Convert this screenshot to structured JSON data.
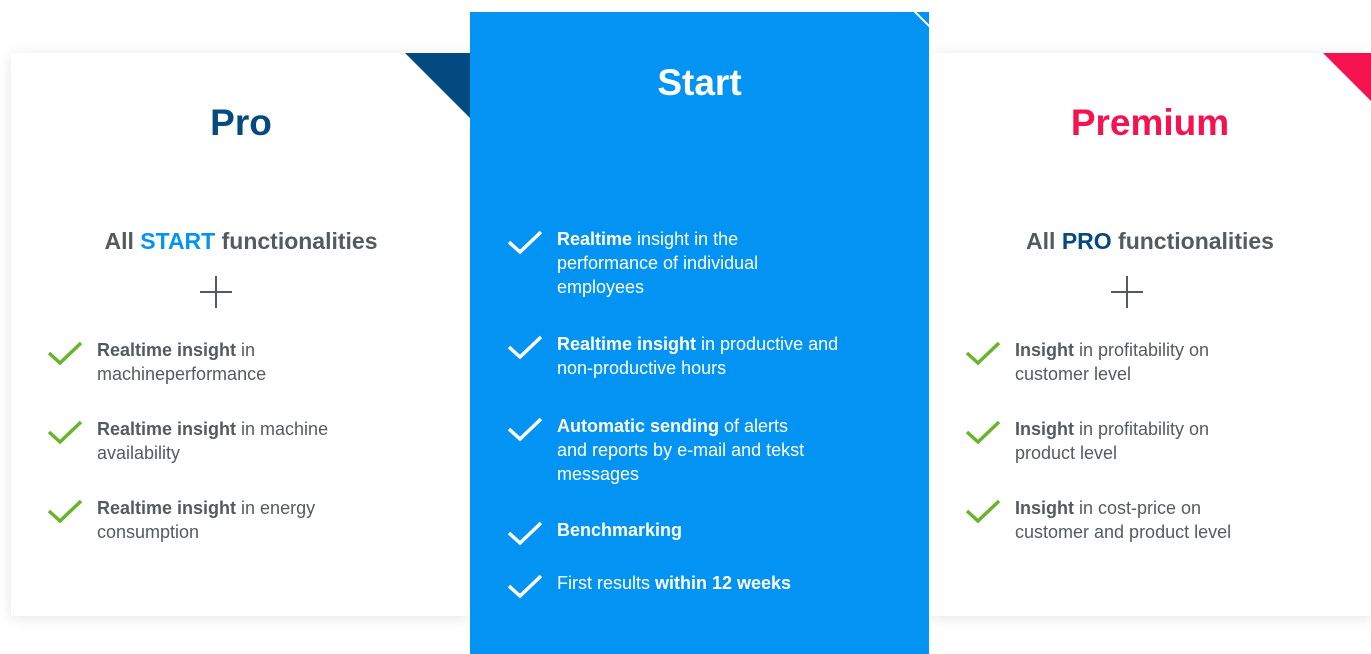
{
  "colors": {
    "pro_blue": "#044a80",
    "start_blue": "#0393f3",
    "premium_red": "#f4134e",
    "check_green": "#6ab42d",
    "text_gray": "#555a60"
  },
  "pro": {
    "title": "Pro",
    "subtitle_prefix": "All",
    "subtitle_highlight": "START",
    "subtitle_suffix": "functionalities",
    "features": [
      {
        "bold": "Realtime insight",
        "line1": " in",
        "line2": "machineperformance"
      },
      {
        "bold": "Realtime insight",
        "line1": " in machine",
        "line2": "availability"
      },
      {
        "bold": "Realtime insight",
        "line1": " in energy",
        "line2": "consumption"
      }
    ]
  },
  "start": {
    "title": "Start",
    "features": [
      {
        "bold": "Realtime",
        "line1": " insight in the",
        "line2": "performance of individual",
        "line3": "employees"
      },
      {
        "bold": "Realtime insight",
        "line1": " in productive and",
        "line2": "non-productive hours"
      },
      {
        "bold": "Automatic sending",
        "line1": " of alerts",
        "line2": "and reports by e-mail and tekst",
        "line3": "messages"
      },
      {
        "bold": "Benchmarking"
      },
      {
        "plain": "First results ",
        "bold": "within 12 weeks"
      }
    ]
  },
  "premium": {
    "title": "Premium",
    "subtitle_prefix": "All",
    "subtitle_highlight": "PRO",
    "subtitle_suffix": "functionalities",
    "features": [
      {
        "bold": "Insight",
        "line1": " in profitability on",
        "line2": "customer level"
      },
      {
        "bold": "Insight",
        "line1": " in profitability on",
        "line2": "product level"
      },
      {
        "bold": "Insight",
        "line1": " in cost-price on",
        "line2": "customer and product level"
      }
    ]
  },
  "icons": {
    "check": "check-icon",
    "plus": "plus-icon"
  }
}
